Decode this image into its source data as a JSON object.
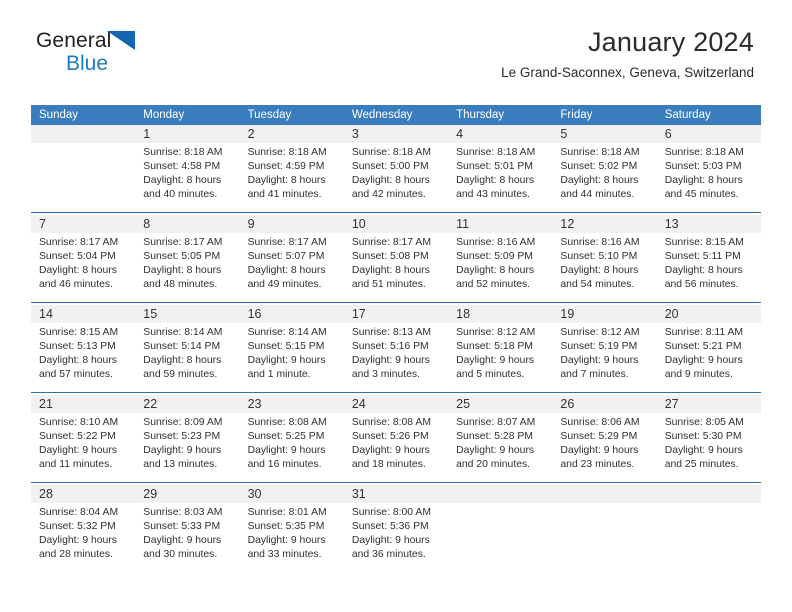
{
  "brand": {
    "name_top": "General",
    "name_bottom": "Blue"
  },
  "header": {
    "title": "January 2024",
    "subtitle": "Le Grand-Saconnex, Geneva, Switzerland"
  },
  "colors": {
    "header_blue": "#3a7dbf",
    "separator_blue": "#2f6fae",
    "daynum_band": "#f1f1f1",
    "brand_blue": "#1a7dc4",
    "brand_dark": "#231f20"
  },
  "weekdays": [
    "Sunday",
    "Monday",
    "Tuesday",
    "Wednesday",
    "Thursday",
    "Friday",
    "Saturday"
  ],
  "weeks": [
    [
      {
        "day": "",
        "sunrise": "",
        "sunset": "",
        "daylight1": "",
        "daylight2": ""
      },
      {
        "day": "1",
        "sunrise": "Sunrise: 8:18 AM",
        "sunset": "Sunset: 4:58 PM",
        "daylight1": "Daylight: 8 hours",
        "daylight2": "and 40 minutes."
      },
      {
        "day": "2",
        "sunrise": "Sunrise: 8:18 AM",
        "sunset": "Sunset: 4:59 PM",
        "daylight1": "Daylight: 8 hours",
        "daylight2": "and 41 minutes."
      },
      {
        "day": "3",
        "sunrise": "Sunrise: 8:18 AM",
        "sunset": "Sunset: 5:00 PM",
        "daylight1": "Daylight: 8 hours",
        "daylight2": "and 42 minutes."
      },
      {
        "day": "4",
        "sunrise": "Sunrise: 8:18 AM",
        "sunset": "Sunset: 5:01 PM",
        "daylight1": "Daylight: 8 hours",
        "daylight2": "and 43 minutes."
      },
      {
        "day": "5",
        "sunrise": "Sunrise: 8:18 AM",
        "sunset": "Sunset: 5:02 PM",
        "daylight1": "Daylight: 8 hours",
        "daylight2": "and 44 minutes."
      },
      {
        "day": "6",
        "sunrise": "Sunrise: 8:18 AM",
        "sunset": "Sunset: 5:03 PM",
        "daylight1": "Daylight: 8 hours",
        "daylight2": "and 45 minutes."
      }
    ],
    [
      {
        "day": "7",
        "sunrise": "Sunrise: 8:17 AM",
        "sunset": "Sunset: 5:04 PM",
        "daylight1": "Daylight: 8 hours",
        "daylight2": "and 46 minutes."
      },
      {
        "day": "8",
        "sunrise": "Sunrise: 8:17 AM",
        "sunset": "Sunset: 5:05 PM",
        "daylight1": "Daylight: 8 hours",
        "daylight2": "and 48 minutes."
      },
      {
        "day": "9",
        "sunrise": "Sunrise: 8:17 AM",
        "sunset": "Sunset: 5:07 PM",
        "daylight1": "Daylight: 8 hours",
        "daylight2": "and 49 minutes."
      },
      {
        "day": "10",
        "sunrise": "Sunrise: 8:17 AM",
        "sunset": "Sunset: 5:08 PM",
        "daylight1": "Daylight: 8 hours",
        "daylight2": "and 51 minutes."
      },
      {
        "day": "11",
        "sunrise": "Sunrise: 8:16 AM",
        "sunset": "Sunset: 5:09 PM",
        "daylight1": "Daylight: 8 hours",
        "daylight2": "and 52 minutes."
      },
      {
        "day": "12",
        "sunrise": "Sunrise: 8:16 AM",
        "sunset": "Sunset: 5:10 PM",
        "daylight1": "Daylight: 8 hours",
        "daylight2": "and 54 minutes."
      },
      {
        "day": "13",
        "sunrise": "Sunrise: 8:15 AM",
        "sunset": "Sunset: 5:11 PM",
        "daylight1": "Daylight: 8 hours",
        "daylight2": "and 56 minutes."
      }
    ],
    [
      {
        "day": "14",
        "sunrise": "Sunrise: 8:15 AM",
        "sunset": "Sunset: 5:13 PM",
        "daylight1": "Daylight: 8 hours",
        "daylight2": "and 57 minutes."
      },
      {
        "day": "15",
        "sunrise": "Sunrise: 8:14 AM",
        "sunset": "Sunset: 5:14 PM",
        "daylight1": "Daylight: 8 hours",
        "daylight2": "and 59 minutes."
      },
      {
        "day": "16",
        "sunrise": "Sunrise: 8:14 AM",
        "sunset": "Sunset: 5:15 PM",
        "daylight1": "Daylight: 9 hours",
        "daylight2": "and 1 minute."
      },
      {
        "day": "17",
        "sunrise": "Sunrise: 8:13 AM",
        "sunset": "Sunset: 5:16 PM",
        "daylight1": "Daylight: 9 hours",
        "daylight2": "and 3 minutes."
      },
      {
        "day": "18",
        "sunrise": "Sunrise: 8:12 AM",
        "sunset": "Sunset: 5:18 PM",
        "daylight1": "Daylight: 9 hours",
        "daylight2": "and 5 minutes."
      },
      {
        "day": "19",
        "sunrise": "Sunrise: 8:12 AM",
        "sunset": "Sunset: 5:19 PM",
        "daylight1": "Daylight: 9 hours",
        "daylight2": "and 7 minutes."
      },
      {
        "day": "20",
        "sunrise": "Sunrise: 8:11 AM",
        "sunset": "Sunset: 5:21 PM",
        "daylight1": "Daylight: 9 hours",
        "daylight2": "and 9 minutes."
      }
    ],
    [
      {
        "day": "21",
        "sunrise": "Sunrise: 8:10 AM",
        "sunset": "Sunset: 5:22 PM",
        "daylight1": "Daylight: 9 hours",
        "daylight2": "and 11 minutes."
      },
      {
        "day": "22",
        "sunrise": "Sunrise: 8:09 AM",
        "sunset": "Sunset: 5:23 PM",
        "daylight1": "Daylight: 9 hours",
        "daylight2": "and 13 minutes."
      },
      {
        "day": "23",
        "sunrise": "Sunrise: 8:08 AM",
        "sunset": "Sunset: 5:25 PM",
        "daylight1": "Daylight: 9 hours",
        "daylight2": "and 16 minutes."
      },
      {
        "day": "24",
        "sunrise": "Sunrise: 8:08 AM",
        "sunset": "Sunset: 5:26 PM",
        "daylight1": "Daylight: 9 hours",
        "daylight2": "and 18 minutes."
      },
      {
        "day": "25",
        "sunrise": "Sunrise: 8:07 AM",
        "sunset": "Sunset: 5:28 PM",
        "daylight1": "Daylight: 9 hours",
        "daylight2": "and 20 minutes."
      },
      {
        "day": "26",
        "sunrise": "Sunrise: 8:06 AM",
        "sunset": "Sunset: 5:29 PM",
        "daylight1": "Daylight: 9 hours",
        "daylight2": "and 23 minutes."
      },
      {
        "day": "27",
        "sunrise": "Sunrise: 8:05 AM",
        "sunset": "Sunset: 5:30 PM",
        "daylight1": "Daylight: 9 hours",
        "daylight2": "and 25 minutes."
      }
    ],
    [
      {
        "day": "28",
        "sunrise": "Sunrise: 8:04 AM",
        "sunset": "Sunset: 5:32 PM",
        "daylight1": "Daylight: 9 hours",
        "daylight2": "and 28 minutes."
      },
      {
        "day": "29",
        "sunrise": "Sunrise: 8:03 AM",
        "sunset": "Sunset: 5:33 PM",
        "daylight1": "Daylight: 9 hours",
        "daylight2": "and 30 minutes."
      },
      {
        "day": "30",
        "sunrise": "Sunrise: 8:01 AM",
        "sunset": "Sunset: 5:35 PM",
        "daylight1": "Daylight: 9 hours",
        "daylight2": "and 33 minutes."
      },
      {
        "day": "31",
        "sunrise": "Sunrise: 8:00 AM",
        "sunset": "Sunset: 5:36 PM",
        "daylight1": "Daylight: 9 hours",
        "daylight2": "and 36 minutes."
      },
      {
        "day": "",
        "sunrise": "",
        "sunset": "",
        "daylight1": "",
        "daylight2": ""
      },
      {
        "day": "",
        "sunrise": "",
        "sunset": "",
        "daylight1": "",
        "daylight2": ""
      },
      {
        "day": "",
        "sunrise": "",
        "sunset": "",
        "daylight1": "",
        "daylight2": ""
      }
    ]
  ]
}
